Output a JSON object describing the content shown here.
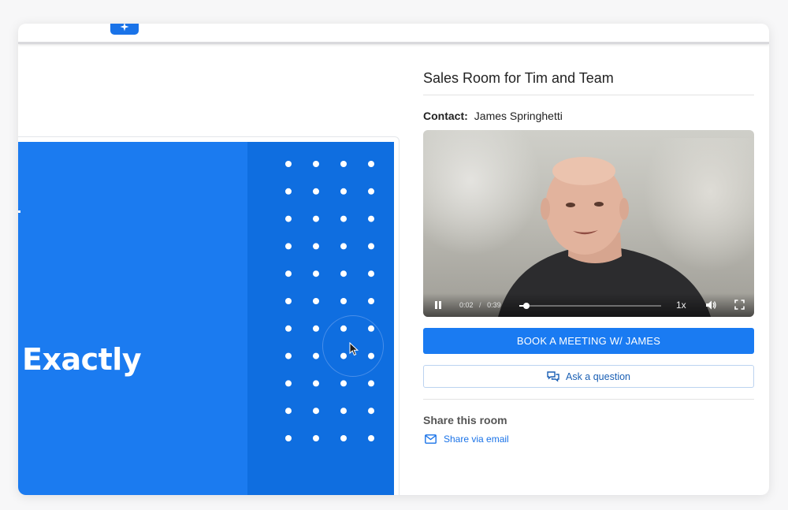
{
  "app": {
    "accent": "#1a7bf2",
    "logo_icon": "star-logo-icon"
  },
  "slide": {
    "headline": "Exactly",
    "background": "#1b7bf0",
    "panel_color": "#0f6ee0",
    "dot_rows": 11,
    "dot_cols": 4
  },
  "room": {
    "title": "Sales Room for Tim and Team",
    "contact_label": "Contact:",
    "contact_name": "James Springhetti"
  },
  "video": {
    "current_time": "0:02",
    "separator": "/",
    "duration": "0:39",
    "progress": 0.05,
    "speed": "1x",
    "icons": [
      "pause-icon",
      "volume-icon",
      "fullscreen-icon"
    ]
  },
  "actions": {
    "book_label": "BOOK A MEETING W/ JAMES",
    "ask_label": "Ask a question",
    "ask_icon": "chat-bubbles-icon"
  },
  "share": {
    "heading": "Share this room",
    "email_label": "Share via email",
    "email_icon": "mail-icon"
  }
}
